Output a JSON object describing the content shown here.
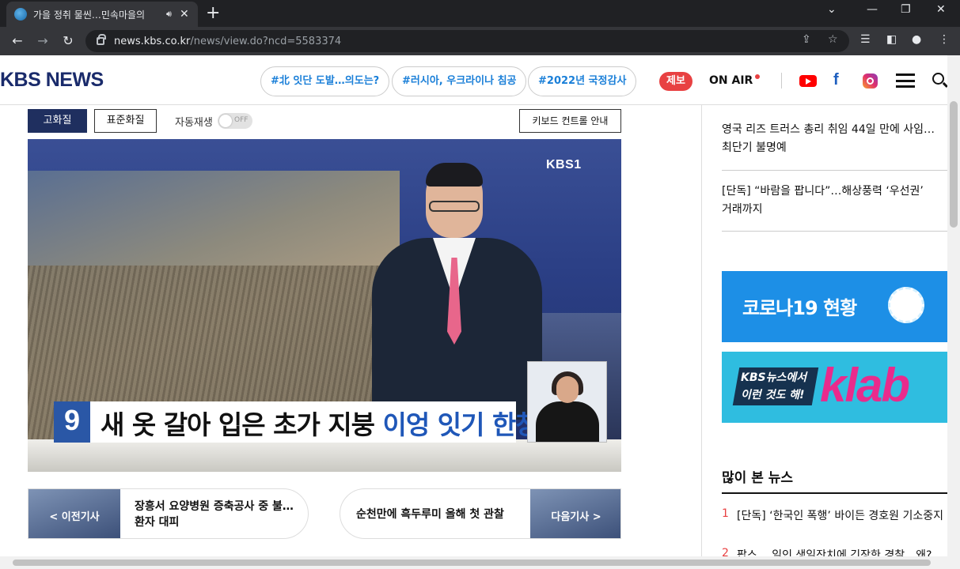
{
  "browser": {
    "tab_title": "가을 정취 물씬…민속마을의",
    "new_tab_glyph": "+",
    "url_host": "news.kbs.co.kr",
    "url_path": "/news/view.do?ncd=5583374"
  },
  "header": {
    "logo": "KBS NEWS",
    "tags": [
      "#北 잇단 도발…의도는?",
      "#러시아, 우크라이나 침공",
      "#2022년 국정감사"
    ],
    "report_label": "제보",
    "onair_label": "ON AIR",
    "facebook_glyph": "f"
  },
  "player": {
    "hd_label": "고화질",
    "sd_label": "표준화질",
    "autoplay_label": "자동재생",
    "toggle_state": "OFF",
    "keyboard_help_label": "키보드 컨트롤 안내",
    "channel_logo": "KBS1",
    "ticker_number": "9",
    "ticker_main": "새 옷 갈아 입은 초가 지붕",
    "ticker_highlight": "이엉 잇기 한창"
  },
  "prev_article": {
    "label": "< 이전기사",
    "title_line1": "장흥서 요양병원 증축공사 중 불…",
    "title_line2": "환자 대피"
  },
  "next_article": {
    "label": "다음기사 >",
    "title": "순천만에 흑두루미 올해 첫 관찰"
  },
  "sidebar": {
    "news": [
      {
        "line1": "영국 리즈 트러스 총리 취임 44일 만에 사임…",
        "line2": "최단기 불명예"
      },
      {
        "line1": "[단독] “바람을 팝니다”…해상풍력 ‘우선권’",
        "line2": "거래까지"
      }
    ],
    "covid_banner": "코로나19 현황",
    "klab_line1": "KBS뉴스에서",
    "klab_line2": "이런 것도 해!",
    "klab_word": "klab",
    "most_viewed_title": "많이 본 뉴스",
    "most_viewed": [
      {
        "rank": "1",
        "text": "[단독] ‘한국인 폭행’ 바이든 경호원 기소중지"
      },
      {
        "rank": "2",
        "text": "팝스… 일인 생일잔치에 긴장한 경찰…왜?"
      }
    ]
  },
  "colors": {
    "brand_navy": "#1a2b6b",
    "accent_red": "#e84142",
    "tag_blue": "#1a7fd8",
    "covid_blue": "#1d8fe6",
    "klab_pink": "#e92b8c"
  }
}
